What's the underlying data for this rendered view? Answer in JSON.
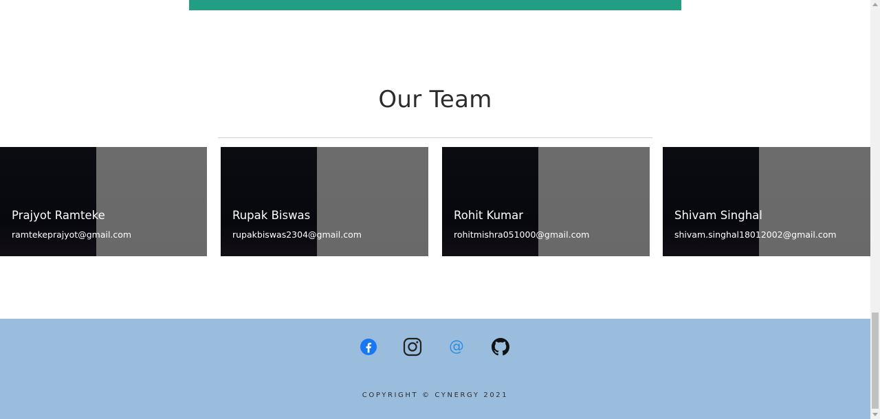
{
  "section": {
    "title": "Our Team"
  },
  "team": [
    {
      "name": "Prajyot Ramteke",
      "email": "ramtekeprajyot@gmail.com"
    },
    {
      "name": "Rupak Biswas",
      "email": "rupakbiswas2304@gmail.com"
    },
    {
      "name": "Rohit Kumar",
      "email": "rohitmishra051000@gmail.com"
    },
    {
      "name": "Shivam Singhal",
      "email": "shivam.singhal18012002@gmail.com"
    }
  ],
  "footer": {
    "socials": [
      {
        "icon": "facebook-icon",
        "color": "#1877f2"
      },
      {
        "icon": "instagram-icon",
        "color": "#222222"
      },
      {
        "icon": "email-at-icon",
        "color": "#2f8ee0"
      },
      {
        "icon": "github-icon",
        "color": "#111111"
      }
    ],
    "copyright": "COPYRIGHT © CYNERGY 2021"
  },
  "colors": {
    "accent_bar": "#229e84",
    "footer_bg": "#9abcdd"
  }
}
